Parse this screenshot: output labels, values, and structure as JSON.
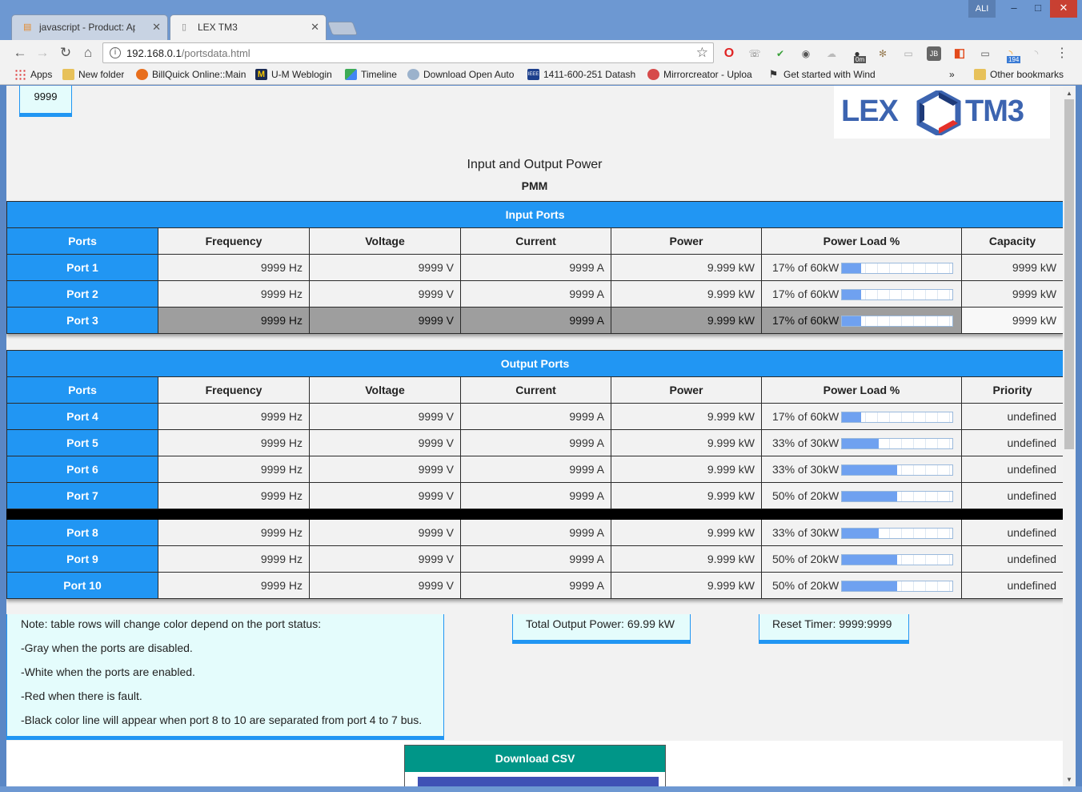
{
  "window": {
    "user_label": "ALI",
    "minimize_glyph": "–",
    "maximize_glyph": "□",
    "close_glyph": "✕"
  },
  "tabs": [
    {
      "label": "javascript - Product: Apta",
      "icon": "stackoverflow-icon",
      "close": "✕"
    },
    {
      "label": "LEX TM3",
      "icon": "page-icon",
      "close": "✕"
    }
  ],
  "toolbar": {
    "back": "←",
    "forward": "→",
    "reload": "↻",
    "home": "⌂",
    "url_host": "192.168.0.1",
    "url_path": "/portsdata.html",
    "info_glyph": "i",
    "star_glyph": "☆",
    "menu_glyph": "⋮",
    "ext_badge_1": "0m",
    "ext_badge_2": "194"
  },
  "bookmarks": [
    {
      "label": "Apps",
      "icon": "apps-grid-icon"
    },
    {
      "label": "New folder",
      "icon": "folder-icon"
    },
    {
      "label": "BillQuick Online::Main",
      "icon": "billquick-icon"
    },
    {
      "label": "U-M Weblogin",
      "icon": "umich-icon"
    },
    {
      "label": "Timeline",
      "icon": "maps-icon"
    },
    {
      "label": "Download Open Auto",
      "icon": "download-icon"
    },
    {
      "label": "1411-600-251 Datash",
      "icon": "ieee-icon"
    },
    {
      "label": "Mirrorcreator - Uploa",
      "icon": "mirrorcreator-icon"
    },
    {
      "label": "Get started with Wind",
      "icon": "windows-icon"
    }
  ],
  "bookmarks_overflow": "»",
  "other_bookmarks": "Other bookmarks",
  "page": {
    "top_value": "9999",
    "logo_left": "LEX",
    "logo_right": "TM3",
    "title": "Input and Output Power",
    "subtitle": "PMM"
  },
  "colors": {
    "header_blue": "#2196f3",
    "disabled_gray": "#9e9e9e",
    "csv_teal": "#009688",
    "csv_indigo": "#3f51b5"
  },
  "input_table": {
    "caption": "Input Ports",
    "headers": [
      "Ports",
      "Frequency",
      "Voltage",
      "Current",
      "Power",
      "Power Load %",
      "Capacity"
    ],
    "rows": [
      {
        "port": "Port 1",
        "frequency": "9999 Hz",
        "voltage": "9999 V",
        "current": "9999 A",
        "power": "9.999 kW",
        "load_text": "17% of 60kW",
        "load_pct": 17,
        "last": "9999 kW",
        "status": "enabled"
      },
      {
        "port": "Port 2",
        "frequency": "9999 Hz",
        "voltage": "9999 V",
        "current": "9999 A",
        "power": "9.999 kW",
        "load_text": "17% of 60kW",
        "load_pct": 17,
        "last": "9999 kW",
        "status": "enabled"
      },
      {
        "port": "Port 3",
        "frequency": "9999 Hz",
        "voltage": "9999 V",
        "current": "9999 A",
        "power": "9.999 kW",
        "load_text": "17% of 60kW",
        "load_pct": 17,
        "last": "9999 kW",
        "status": "disabled"
      }
    ]
  },
  "output_table": {
    "caption": "Output Ports",
    "headers": [
      "Ports",
      "Frequency",
      "Voltage",
      "Current",
      "Power",
      "Power Load %",
      "Priority"
    ],
    "rows": [
      {
        "port": "Port 4",
        "frequency": "9999 Hz",
        "voltage": "9999 V",
        "current": "9999 A",
        "power": "9.999 kW",
        "load_text": "17% of 60kW",
        "load_pct": 17,
        "last": "undefined",
        "status": "enabled"
      },
      {
        "port": "Port 5",
        "frequency": "9999 Hz",
        "voltage": "9999 V",
        "current": "9999 A",
        "power": "9.999 kW",
        "load_text": "33% of 30kW",
        "load_pct": 33,
        "last": "undefined",
        "status": "enabled"
      },
      {
        "port": "Port 6",
        "frequency": "9999 Hz",
        "voltage": "9999 V",
        "current": "9999 A",
        "power": "9.999 kW",
        "load_text": "33% of 30kW",
        "load_pct": 50,
        "last": "undefined",
        "status": "enabled"
      },
      {
        "port": "Port 7",
        "frequency": "9999 Hz",
        "voltage": "9999 V",
        "current": "9999 A",
        "power": "9.999 kW",
        "load_text": "50% of 20kW",
        "load_pct": 50,
        "last": "undefined",
        "status": "enabled"
      },
      {
        "separator": true
      },
      {
        "port": "Port 8",
        "frequency": "9999 Hz",
        "voltage": "9999 V",
        "current": "9999 A",
        "power": "9.999 kW",
        "load_text": "33% of 30kW",
        "load_pct": 33,
        "last": "undefined",
        "status": "enabled"
      },
      {
        "port": "Port 9",
        "frequency": "9999 Hz",
        "voltage": "9999 V",
        "current": "9999 A",
        "power": "9.999 kW",
        "load_text": "50% of 20kW",
        "load_pct": 50,
        "last": "undefined",
        "status": "enabled"
      },
      {
        "port": "Port 10",
        "frequency": "9999 Hz",
        "voltage": "9999 V",
        "current": "9999 A",
        "power": "9.999 kW",
        "load_text": "50% of 20kW",
        "load_pct": 50,
        "last": "undefined",
        "status": "enabled"
      }
    ]
  },
  "note": {
    "lines": [
      "Note: table rows will change color depend on the port status:",
      "-Gray when the ports are disabled.",
      "-White when the ports are enabled.",
      "-Red when there is fault.",
      "-Black color line will appear when port 8 to 10 are separated from port 4 to 7 bus."
    ]
  },
  "total_output": "Total Output Power: 69.99 kW",
  "reset_timer": "Reset Timer: 9999:9999",
  "download_csv": "Download CSV"
}
